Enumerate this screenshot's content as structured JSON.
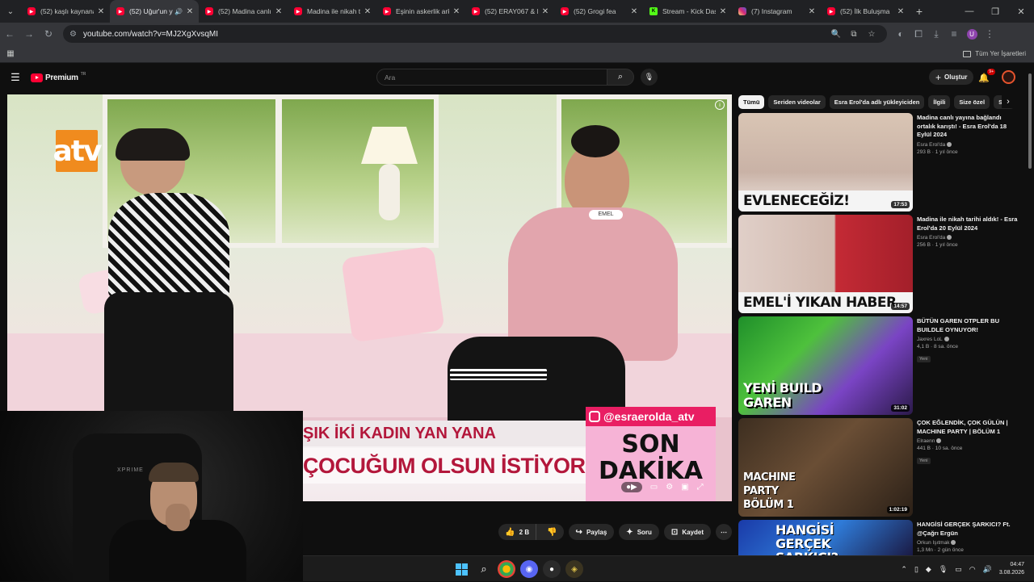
{
  "browser": {
    "tabs": [
      {
        "title": "(52) kaşlı kaynana",
        "icon": "youtube-icon",
        "active": false
      },
      {
        "title": "(52) Uğur'un y",
        "icon": "youtube-icon",
        "active": true,
        "audio": true
      },
      {
        "title": "(52) Madina canlı",
        "icon": "youtube-icon",
        "active": false
      },
      {
        "title": "Madina ile nikah t",
        "icon": "youtube-icon",
        "active": false
      },
      {
        "title": "Eşinin askerlik ark",
        "icon": "youtube-icon",
        "active": false
      },
      {
        "title": "(52) ERAY067 & M",
        "icon": "youtube-icon",
        "active": false
      },
      {
        "title": "(52) Grogi fea",
        "icon": "youtube-icon",
        "active": false
      },
      {
        "title": "Stream - Kick Das",
        "icon": "kick-icon",
        "active": false
      },
      {
        "title": "(7) Instagram",
        "icon": "instagram-icon",
        "active": false
      },
      {
        "title": "(52) İlk Buluşma",
        "icon": "youtube-icon",
        "active": false
      }
    ],
    "url": "youtube.com/watch?v=MJ2XgXvsqMI",
    "bookmarks_all": "Tüm Yer İşaretleri",
    "profile_initial": "U"
  },
  "youtube": {
    "logo_text": "Premium",
    "logo_country": "TR",
    "search_placeholder": "Ara",
    "create_label": "Oluştur",
    "notif_count": "9+",
    "actions": {
      "like_count": "2 B",
      "share": "Paylaş",
      "ask": "Soru",
      "save": "Kaydet"
    }
  },
  "video": {
    "channel_logo": "atv",
    "headline_line1": "ŞIK İKİ KADIN YAN YANA",
    "headline_line2": "ÇOCUĞUM OLSUN İSTİYORUM",
    "instagram_handle": "@esraerolda_atv",
    "breaking_line1": "SON",
    "breaking_line2": "DAKİKA",
    "name_tag": "EMEL"
  },
  "webcam": {
    "brand": "XPRIME"
  },
  "chips": [
    "Tümü",
    "Seriden videolar",
    "Esra Erol'da adlı yükleyiciden",
    "İlgili",
    "Size özel",
    "Son"
  ],
  "recommendations": [
    {
      "title": "Madina canlı yayına bağlandı ortalık karıştı! - Esra Erol'da 18 Eylül 2024",
      "channel": "Esra Erol'da",
      "stats": "293 B · 1 yıl önce",
      "duration": "17:53",
      "thumb_text": "EVLENECEĞİZ!",
      "is_new": false
    },
    {
      "title": "Madina ile nikah tarihi aldık! - Esra Erol'da 20 Eylül 2024",
      "channel": "Esra Erol'da",
      "stats": "256 B · 1 yıl önce",
      "duration": "14:57",
      "thumb_text": "EMEL'İ YIKAN HABER",
      "is_new": false
    },
    {
      "title": "BÜTÜN GAREN OTPLER BU BUILDLE OYNUYOR!",
      "channel": "Jaxres LoL",
      "stats": "4,1 B · 8 sa. önce",
      "duration": "31:02",
      "thumb_text": "YENİ BUILD GAREN",
      "is_new": true,
      "new_label": "Yeni"
    },
    {
      "title": "ÇOK EĞLENDİK, ÇOK GÜLÜN | MACHINE PARTY | BÖLÜM 1",
      "channel": "Elraenn",
      "stats": "441 B · 10 sa. önce",
      "duration": "1:02:19",
      "thumb_text": "MACHINE PARTY BÖLÜM 1",
      "is_new": true,
      "new_label": "Yeni"
    },
    {
      "title": "HANGİSİ GERÇEK ŞARKICI? Ft. @Çağrı Ergün",
      "channel": "Orkun Işıtmak",
      "stats": "1,3 Mn · 2 gün önce",
      "duration": "",
      "thumb_text": "HANGİSİ GERÇEK ŞARKICI?",
      "is_new": false
    }
  ],
  "taskbar": {
    "time": "04:47",
    "date": "3.08.2026"
  },
  "colors": {
    "youtube_red": "#ff0033",
    "headline_red": "#b3173b",
    "instagram_pink": "#e91e63",
    "breaking_bg": "#f6b3d6",
    "windows_accent": "#4cc2ff"
  }
}
